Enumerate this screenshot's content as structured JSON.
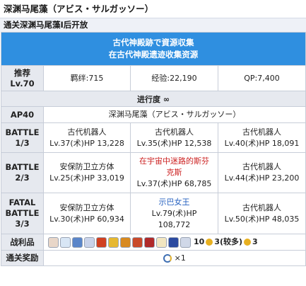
{
  "header": {
    "title": "深渊马尾藻（アビス・サルガッソー）",
    "unlock": "通关深渊马尾藻Ⅰ后开放"
  },
  "banner": {
    "line1": "古代神殿跡で資源収集",
    "line2": "在古代神殿遗迹收集资源"
  },
  "recommend": {
    "label_line1": "推荐",
    "label_line2": "Lv.70",
    "bond": "羁绊:715",
    "exp": "经验:22,190",
    "qp": "QP:7,400"
  },
  "progress": "进行度 ∞",
  "ap": {
    "label": "AP40",
    "quest_name": "深渊马尾藻（アビス・サルガッソー）"
  },
  "battles": [
    {
      "label_line1": "BATTLE",
      "label_line2": "1/3",
      "enemies": [
        {
          "name": "古代机器人",
          "stats": "Lv.37(术)HP 13,228"
        },
        {
          "name": "古代机器人",
          "stats": "Lv.35(术)HP 12,538"
        },
        {
          "name": "古代机器人",
          "stats": "Lv.40(术)HP 18,091"
        }
      ]
    },
    {
      "label_line1": "BATTLE",
      "label_line2": "2/3",
      "enemies": [
        {
          "name": "安保防卫立方体",
          "stats": "Lv.25(术)HP 33,019"
        },
        {
          "name_line1": "在宇宙中迷路的斯芬",
          "name_line2": "克斯",
          "stats": "Lv.37(术)HP 68,785"
        },
        {
          "name": "古代机器人",
          "stats": "Lv.44(术)HP 23,200"
        }
      ]
    },
    {
      "label_line1": "FATAL",
      "label_line2": "BATTLE",
      "label_line3": "3/3",
      "enemies": [
        {
          "name": "安保防卫立方体",
          "stats": "Lv.30(术)HP 60,934"
        },
        {
          "name": "示巴女王",
          "stats_line1": "Lv.79(术)HP",
          "stats_line2": "108,772"
        },
        {
          "name": "古代机器人",
          "stats": "Lv.50(术)HP 48,035"
        }
      ]
    }
  ],
  "drops": {
    "label": "战利品",
    "icon_colors": [
      "#e8d6c8",
      "#d8e6f5",
      "#5b86c9",
      "#c9d3ea",
      "#d04020",
      "#e6b830",
      "#d88a20",
      "#c94a2a",
      "#b02a2a",
      "#f2e6c0",
      "#2b4aa0",
      "#d0d8e8"
    ],
    "count1": "10",
    "count2": "3(较多)",
    "count3": "3"
  },
  "reward": {
    "label": "通关奖励",
    "count": "×1"
  }
}
